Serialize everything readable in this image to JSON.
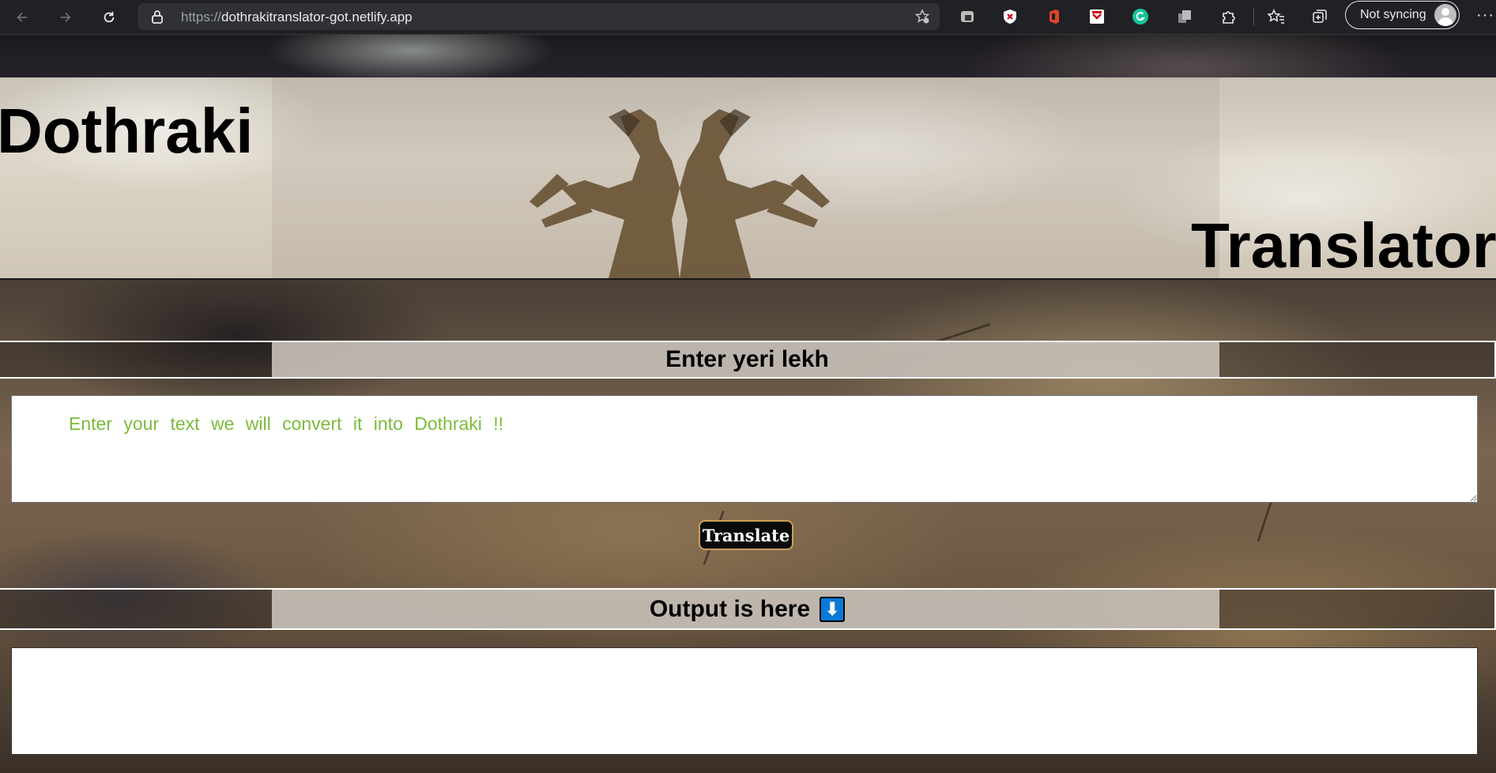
{
  "browser": {
    "url_prefix": "https://",
    "url_host": "dothrakitranslator-got.netlify.app",
    "profile_label": "Not syncing",
    "extensions": [
      "shield-extension",
      "adblock-extension",
      "office-extension",
      "pocket-extension",
      "grammarly-extension",
      "copy-extension",
      "puzzle-extension"
    ]
  },
  "header": {
    "title_left": "Dothraki",
    "title_right": "Translator"
  },
  "input_section": {
    "label": "Enter yeri lekh",
    "placeholder": "Enter your text we will convert it into Dothraki !!"
  },
  "translate_button": "Translate",
  "output_section": {
    "label": "Output is here",
    "arrow_glyph": "⬇"
  },
  "colors": {
    "placeholder": "#7cbb3c",
    "button_border": "#c9a15a",
    "arrow_box": "#0a78d7"
  }
}
